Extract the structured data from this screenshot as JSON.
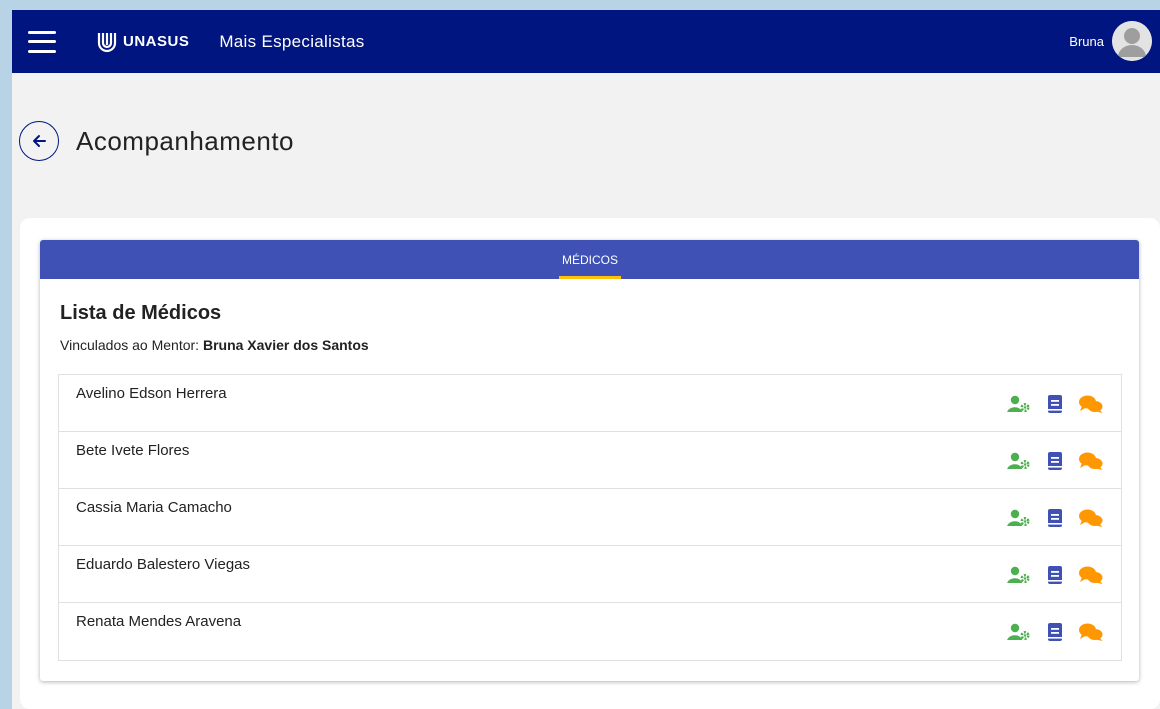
{
  "header": {
    "logo_text": "UNASUS",
    "app_title": "Mais Especialistas",
    "user_name": "Bruna",
    "bar_color": "#00157f"
  },
  "page": {
    "title": "Acompanhamento"
  },
  "tabs": [
    {
      "label": "MÉDICOS",
      "active": true
    }
  ],
  "list": {
    "title": "Lista de Médicos",
    "mentor_prefix": "Vinculados ao Mentor: ",
    "mentor_name": "Bruna Xavier dos Santos",
    "rows": [
      {
        "name": "Avelino Edson Herrera"
      },
      {
        "name": "Bete Ivete Flores"
      },
      {
        "name": "Cassia Maria Camacho"
      },
      {
        "name": "Eduardo Balestero Viegas"
      },
      {
        "name": "Renata Mendes Aravena"
      }
    ]
  },
  "icons": {
    "menu": "hamburger-menu-icon",
    "back": "arrow-left-icon",
    "profile": "user-cog-icon",
    "book": "book-icon",
    "chat": "chat-bubbles-icon"
  },
  "colors": {
    "tab_bar": "#3f51b5",
    "tab_indicator": "#ffc107",
    "profile_icon": "#4caf50",
    "book_icon": "#3f51b5",
    "chat_icon": "#ff9800"
  }
}
